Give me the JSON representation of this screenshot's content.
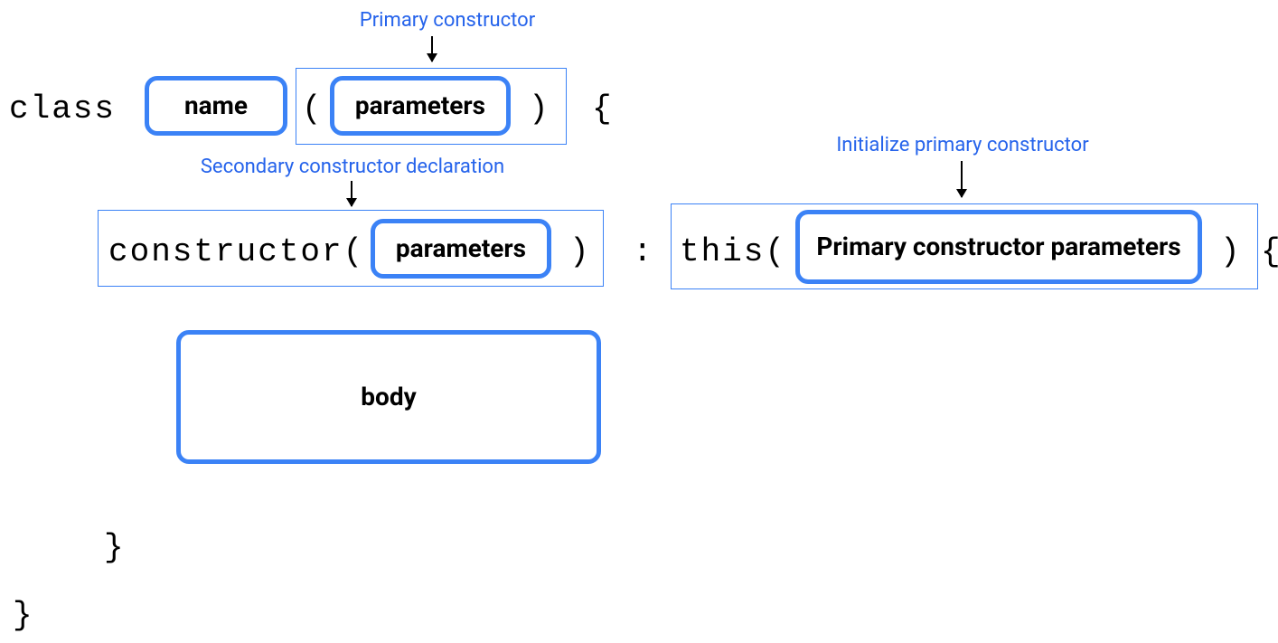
{
  "labels": {
    "primary_constructor": "Primary constructor",
    "secondary_constructor_declaration": "Secondary constructor declaration",
    "initialize_primary_constructor": "Initialize primary constructor"
  },
  "syntax": {
    "class_keyword": "class",
    "name_placeholder": "name",
    "parameters_placeholder": "parameters",
    "open_paren": "(",
    "close_paren": ")",
    "close_paren_open_brace": ") {",
    "open_brace": "{",
    "close_brace": "}",
    "constructor_keyword_open": "constructor(",
    "colon": ":",
    "this_open": "this(",
    "primary_constructor_parameters": "Primary constructor parameters",
    "body_placeholder": "body",
    "close_paren_open_brace2": "){"
  }
}
